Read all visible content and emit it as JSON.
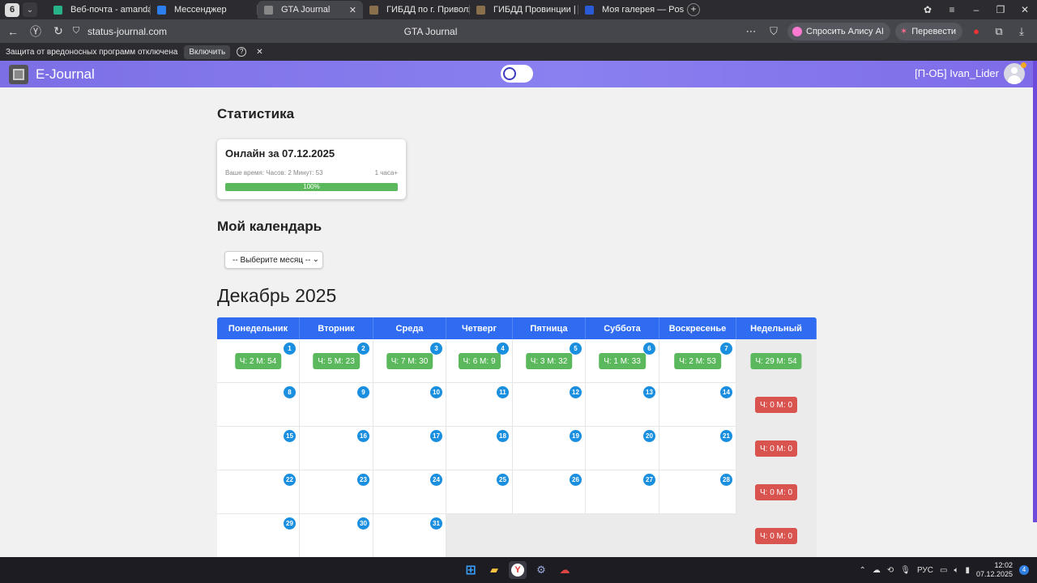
{
  "browser": {
    "tab_count": "6",
    "tabs": [
      {
        "title": "Веб-почта - amandaflores",
        "color": "#27b28a"
      },
      {
        "title": "Мессенджер",
        "color": "#2d7ff0"
      },
      {
        "title": "GTA Journal",
        "color": "#888888"
      },
      {
        "title": "ГИБДД по г. Приволжск",
        "color": "#8a6f4d"
      },
      {
        "title": "ГИБДД Провинции | Бал",
        "color": "#8a6f4d"
      },
      {
        "title": "Моя галерея — Postimage",
        "color": "#2a5bd7"
      }
    ],
    "url": "status-journal.com",
    "page_title": "GTA Journal",
    "ask_alice": "Спросить Алису AI",
    "translate": "Перевести",
    "infobar_text": "Защита от вредоносных программ отключена",
    "infobar_button": "Включить"
  },
  "app": {
    "brand": "E-Journal",
    "user": "[П-ОБ] Ivan_Lider",
    "accent": "#7c6fe6"
  },
  "stats": {
    "heading": "Статистика",
    "card_title": "Онлайн за 07.12.2025",
    "time_text": "Ваше время: Часов: 2 Минут: 53",
    "target_text": "1 часа+",
    "progress_label": "100%",
    "progress_value": 100
  },
  "calendar": {
    "heading": "Мой календарь",
    "select_placeholder": "-- Выберите месяц --",
    "month_title": "Декабрь 2025",
    "headers": [
      "Понедельник",
      "Вторник",
      "Среда",
      "Четверг",
      "Пятница",
      "Суббота",
      "Воскресенье",
      "Недельный"
    ],
    "weeks": [
      {
        "days": [
          {
            "num": "1",
            "time": "Ч: 2 М: 54"
          },
          {
            "num": "2",
            "time": "Ч: 5 М: 23"
          },
          {
            "num": "3",
            "time": "Ч: 7 М: 30"
          },
          {
            "num": "4",
            "time": "Ч: 6 М: 9"
          },
          {
            "num": "5",
            "time": "Ч: 3 М: 32"
          },
          {
            "num": "6",
            "time": "Ч: 1 М: 33"
          },
          {
            "num": "7",
            "time": "Ч: 2 М: 53"
          }
        ],
        "weekly": "Ч: 29 М: 54",
        "weekly_status": "green"
      },
      {
        "days": [
          {
            "num": "8"
          },
          {
            "num": "9"
          },
          {
            "num": "10"
          },
          {
            "num": "11"
          },
          {
            "num": "12"
          },
          {
            "num": "13"
          },
          {
            "num": "14"
          }
        ],
        "weekly": "Ч: 0 М: 0",
        "weekly_status": "red"
      },
      {
        "days": [
          {
            "num": "15"
          },
          {
            "num": "16"
          },
          {
            "num": "17"
          },
          {
            "num": "18"
          },
          {
            "num": "19"
          },
          {
            "num": "20"
          },
          {
            "num": "21"
          }
        ],
        "weekly": "Ч: 0 М: 0",
        "weekly_status": "red"
      },
      {
        "days": [
          {
            "num": "22"
          },
          {
            "num": "23"
          },
          {
            "num": "24"
          },
          {
            "num": "25"
          },
          {
            "num": "26"
          },
          {
            "num": "27"
          },
          {
            "num": "28"
          }
        ],
        "weekly": "Ч: 0 М: 0",
        "weekly_status": "red"
      },
      {
        "days": [
          {
            "num": "29"
          },
          {
            "num": "30"
          },
          {
            "num": "31"
          },
          {},
          {},
          {},
          {}
        ],
        "weekly": "Ч: 0 М: 0",
        "weekly_status": "red"
      }
    ]
  },
  "taskbar": {
    "lang": "РУС",
    "time": "12:02",
    "date": "07.12.2025",
    "notifications": "4"
  }
}
